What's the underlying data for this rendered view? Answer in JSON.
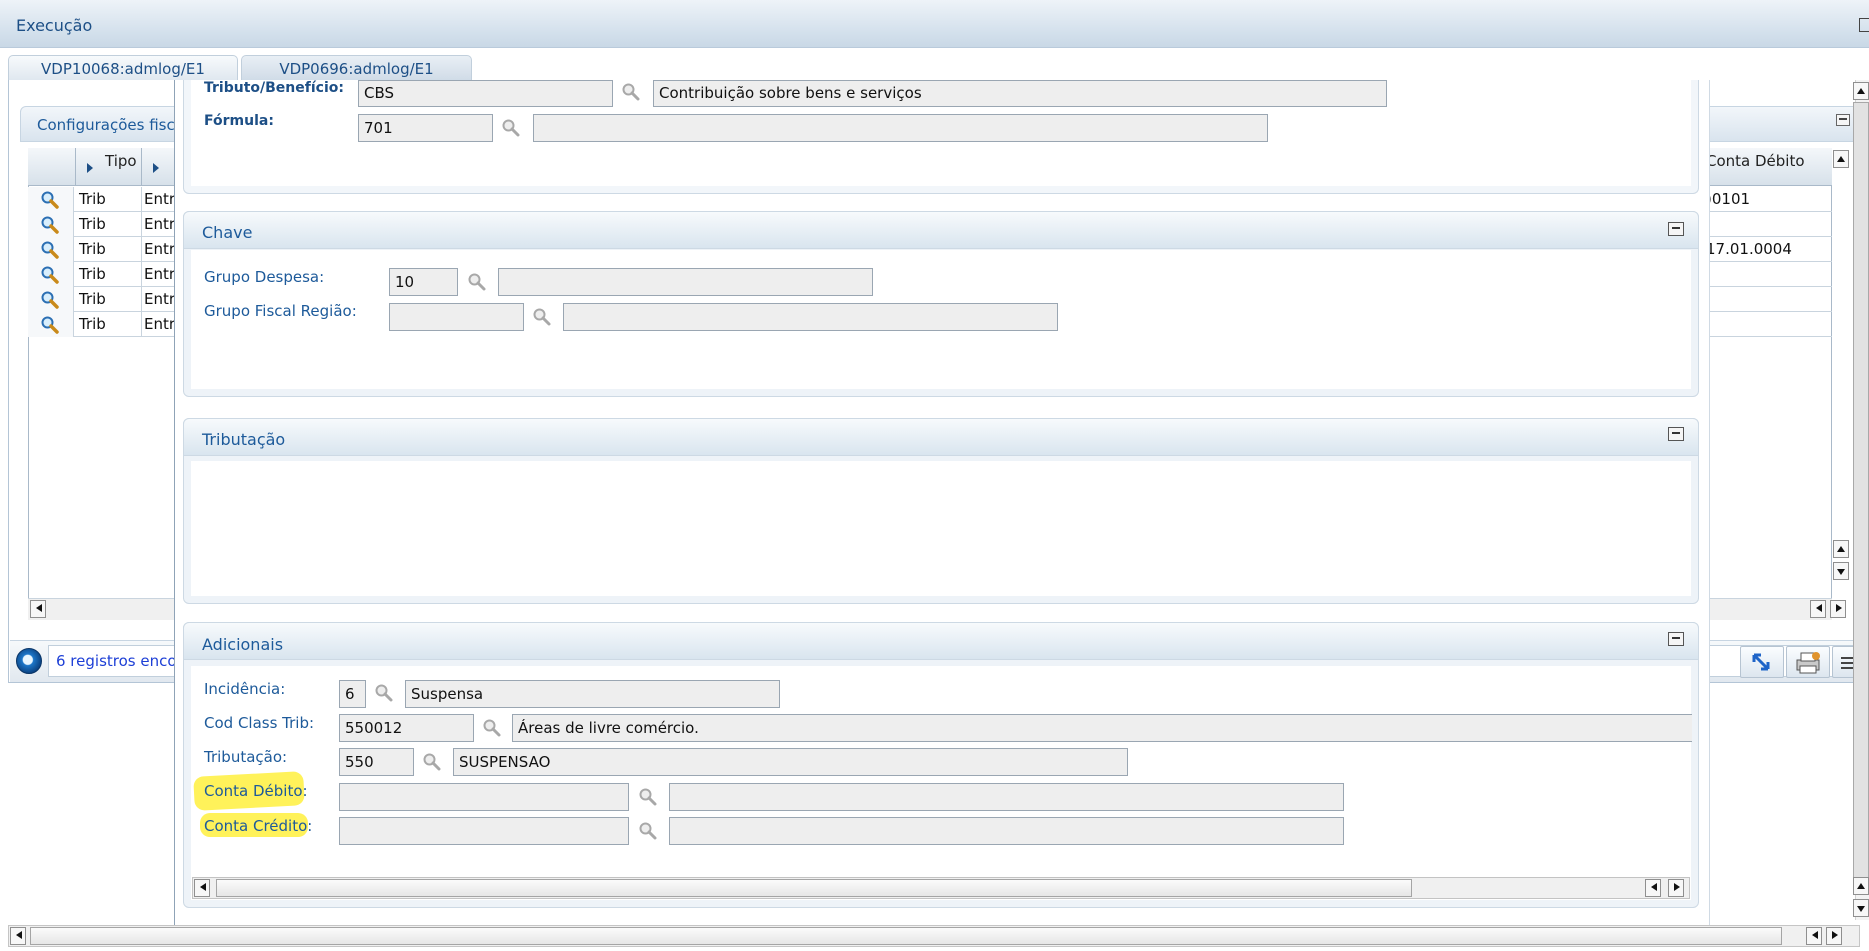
{
  "window": {
    "title": "Execução",
    "tabs": [
      {
        "label": "VDP10068:admlog/E1"
      },
      {
        "label": "VDP0696:admlog/E1"
      }
    ]
  },
  "background": {
    "panel_title": "Configurações fisc",
    "grid": {
      "columns": [
        "Tipo",
        "Conta Débito"
      ],
      "rows": [
        {
          "tipo": "Trib",
          "col2": "Entr",
          "conta": ")0101"
        },
        {
          "tipo": "Trib",
          "col2": "Entr",
          "conta": ""
        },
        {
          "tipo": "Trib",
          "col2": "Entr",
          "conta": "17.01.0004"
        },
        {
          "tipo": "Trib",
          "col2": "Entr",
          "conta": ""
        },
        {
          "tipo": "Trib",
          "col2": "Entr",
          "conta": ""
        },
        {
          "tipo": "Trib",
          "col2": "Entr",
          "conta": ""
        }
      ]
    },
    "status_text": "6 registros enco"
  },
  "modal": {
    "top_section": {
      "tributo_label": "Tributo/Benefício:",
      "tributo_code": "CBS",
      "tributo_desc": "Contribuição sobre bens e serviços",
      "formula_label": "Fórmula:",
      "formula_code": "701",
      "formula_desc": ""
    },
    "chave": {
      "title": "Chave",
      "grupo_despesa_label": "Grupo Despesa:",
      "grupo_despesa_code": "10",
      "grupo_despesa_desc": "",
      "grupo_fiscal_label": "Grupo Fiscal Região:",
      "grupo_fiscal_code": "",
      "grupo_fiscal_desc": ""
    },
    "tributacao_panel": {
      "title": "Tributação"
    },
    "adicionais": {
      "title": "Adicionais",
      "incidencia_label": "Incidência:",
      "incidencia_code": "6",
      "incidencia_desc": "Suspensa",
      "cod_class_label": "Cod Class Trib:",
      "cod_class_code": "550012",
      "cod_class_desc": "Áreas de livre comércio.",
      "tributacao_label": "Tributação:",
      "tributacao_code": "550",
      "tributacao_desc": "SUSPENSAO",
      "conta_debito_label": "Conta Débito:",
      "conta_debito_code": "",
      "conta_debito_desc": "",
      "conta_credito_label": "Conta Crédito:",
      "conta_credito_code": "",
      "conta_credito_desc": ""
    }
  },
  "icons": {
    "lookup": "magnifier-icon",
    "minimize": "minimize-icon",
    "highlight_color": "#fff25a",
    "accent_color": "#1d5a9a"
  }
}
